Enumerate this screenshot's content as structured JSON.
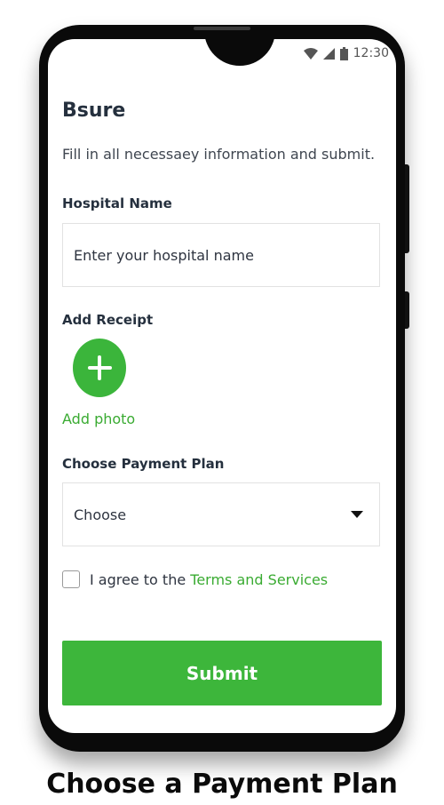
{
  "status_bar": {
    "time": "12:30"
  },
  "app": {
    "title": "Bsure",
    "subtitle": "Fill in all necessaey information and submit."
  },
  "hospital": {
    "label": "Hospital Name",
    "placeholder": "Enter your hospital name"
  },
  "receipt": {
    "label": "Add Receipt",
    "add_photo": "Add photo"
  },
  "payment_plan": {
    "label": "Choose Payment Plan",
    "selected": "Choose"
  },
  "terms": {
    "checked": false,
    "prefix": "I agree to the ",
    "link": "Terms and Services"
  },
  "submit_label": "Submit",
  "caption": "Choose a Payment Plan",
  "colors": {
    "accent": "#3db63b",
    "text_dark": "#25303e"
  },
  "icons": [
    "wifi-icon",
    "signal-icon",
    "battery-icon",
    "plus-icon",
    "caret-down-icon"
  ]
}
